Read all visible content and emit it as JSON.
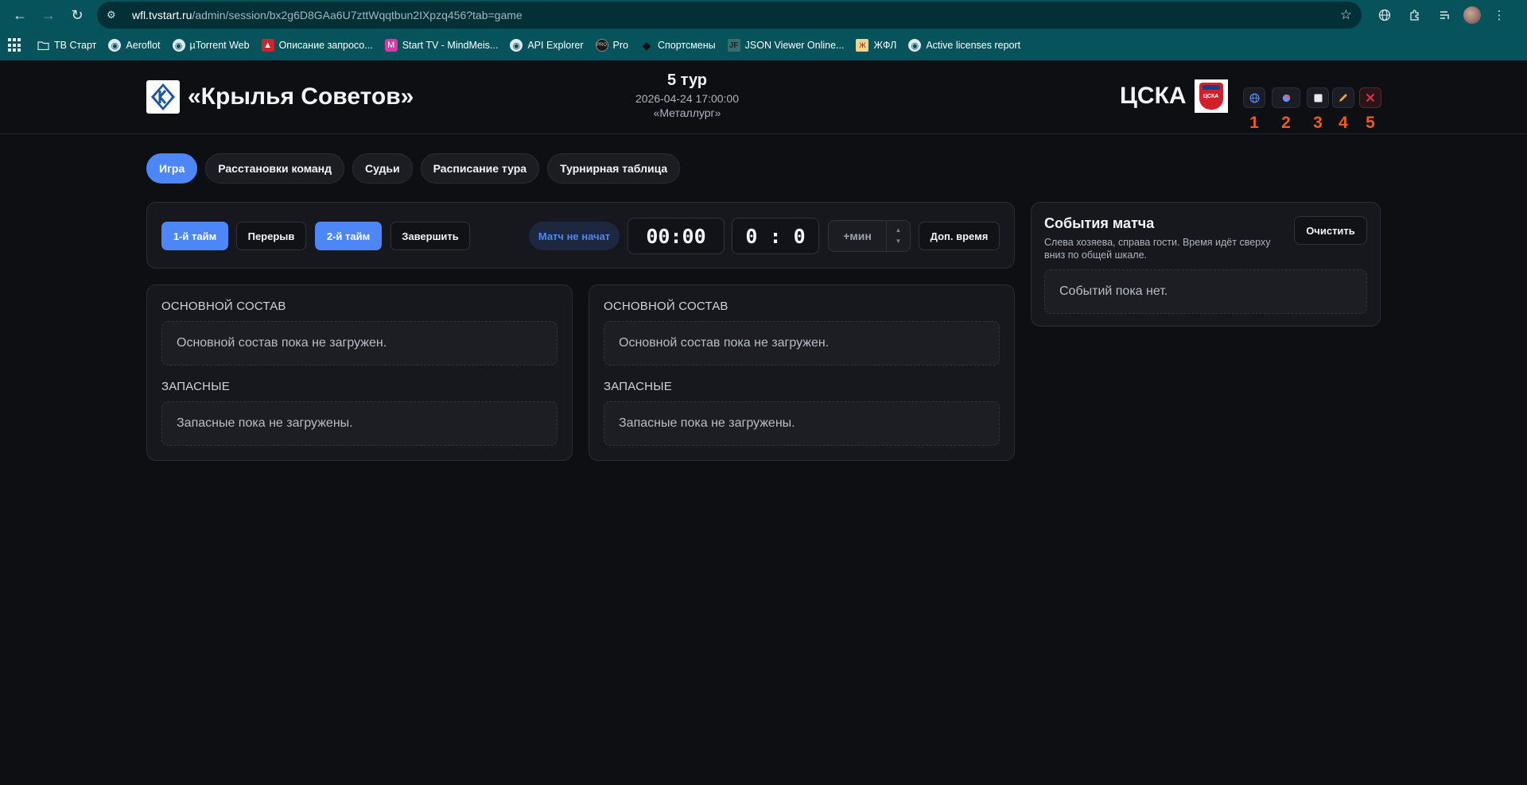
{
  "browser": {
    "url_host": "wfl.tvstart.ru",
    "url_path": "/admin/session/bx2g6D8GAa6U7zttWqqtbun2IXpzq456?tab=game",
    "bookmarks": [
      {
        "label": "ТВ Старт",
        "icon": "folder-icon"
      },
      {
        "label": "Aeroflot",
        "icon": "globe-icon"
      },
      {
        "label": "µTorrent Web",
        "icon": "globe-icon"
      },
      {
        "label": "Описание запросо...",
        "icon": "pdf-icon"
      },
      {
        "label": "Start TV - MindMeis...",
        "icon": "mindmeister-icon"
      },
      {
        "label": "API Explorer",
        "icon": "globe-icon"
      },
      {
        "label": "Pro",
        "icon": "pro-icon"
      },
      {
        "label": "Спортсмены",
        "icon": "diamond-icon"
      },
      {
        "label": "JSON Viewer Online...",
        "icon": "jf-icon"
      },
      {
        "label": "ЖФЛ",
        "icon": "zhfl-icon"
      },
      {
        "label": "Active licenses report",
        "icon": "globe-icon"
      }
    ]
  },
  "match": {
    "home_team": "«Крылья Советов»",
    "away_team": "ЦСКА",
    "tour": "5 тур",
    "datetime": "2026-04-24 17:00:00",
    "venue": "«Металлург»"
  },
  "header_controls": [
    {
      "name": "globe-button",
      "icon": "globe-icon",
      "number": "1",
      "color": "#4d86f7"
    },
    {
      "name": "overlay-button",
      "icon": "layers-icon",
      "number": "2",
      "color": "#6b8ff5"
    },
    {
      "name": "stop-button",
      "icon": "square-icon",
      "number": "3",
      "color": "#e8eaed"
    },
    {
      "name": "edit-button",
      "icon": "pencil-icon",
      "number": "4",
      "color": "#f0a04b"
    },
    {
      "name": "close-button",
      "icon": "close-icon",
      "number": "5",
      "color": "#e0344e"
    }
  ],
  "tabs": [
    {
      "label": "Игра",
      "active": true
    },
    {
      "label": "Расстановки команд",
      "active": false
    },
    {
      "label": "Судьи",
      "active": false
    },
    {
      "label": "Расписание тура",
      "active": false
    },
    {
      "label": "Турнирная таблица",
      "active": false
    }
  ],
  "controls": {
    "first_half": "1-й тайм",
    "break": "Перерыв",
    "second_half": "2-й тайм",
    "finish": "Завершить",
    "status": "Матч не начат",
    "timer": "00:00",
    "score": "0 : 0",
    "add_minutes_placeholder": "+мин",
    "extra_time": "Доп. время"
  },
  "lineups": {
    "main_label": "ОСНОВНОЙ СОСТАВ",
    "main_empty": "Основной состав пока не загружен.",
    "subs_label": "ЗАПАСНЫЕ",
    "subs_empty": "Запасные пока не загружены."
  },
  "events": {
    "title": "События матча",
    "description": "Слева хозяева, справа гости. Время идёт сверху вниз по общей шкале.",
    "clear": "Очистить",
    "empty": "Событий пока нет."
  },
  "colors": {
    "accent": "#4d86f7",
    "annotation": "#f05a1d",
    "background": "#0e0f13",
    "browser_bar": "#07535c"
  }
}
